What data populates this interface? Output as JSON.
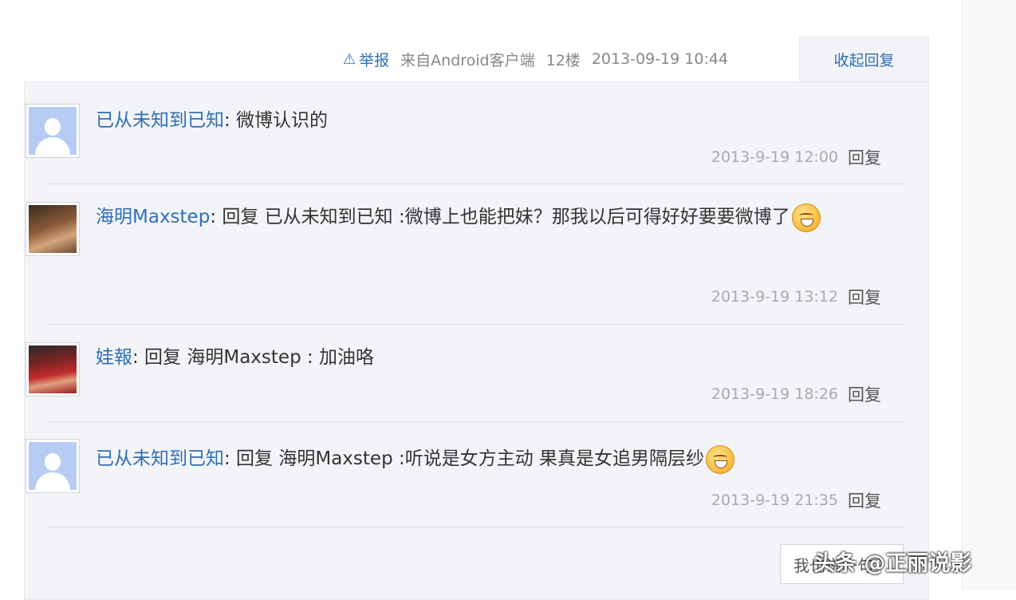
{
  "header": {
    "report_label": "举报",
    "source": "来自Android客户端",
    "floor": "12楼",
    "datetime": "2013-09-19 10:44",
    "collapse_label": "收起回复"
  },
  "replies": [
    {
      "username": "已从未知到已知",
      "separator": ":",
      "text": " 微博认识的",
      "time": "2013-9-19 12:00",
      "reply_label": "回复",
      "has_emoji": false
    },
    {
      "username": "海明Maxstep",
      "separator": ":",
      "text": " 回复 已从未知到已知 :微博上也能把妹？那我以后可得好好要要微博了",
      "time": "2013-9-19 13:12",
      "reply_label": "回复",
      "has_emoji": true
    },
    {
      "username": "娃報",
      "separator": ":",
      "text": " 回复 海明Maxstep : 加油咯",
      "time": "2013-9-19 18:26",
      "reply_label": "回复",
      "has_emoji": false
    },
    {
      "username": "已从未知到已知",
      "separator": ":",
      "text": " 回复 海明Maxstep :听说是女方主动 果真是女追男隔层纱",
      "time": "2013-9-19 21:35",
      "reply_label": "回复",
      "has_emoji": true
    }
  ],
  "footer": {
    "my_reply_label": "我也说一句",
    "watermark": "头条 @正丽说影"
  },
  "colors": {
    "link": "#2f6fb3",
    "panel_bg": "#f3f4f8",
    "text": "#333333",
    "meta": "#aaaaaa"
  }
}
